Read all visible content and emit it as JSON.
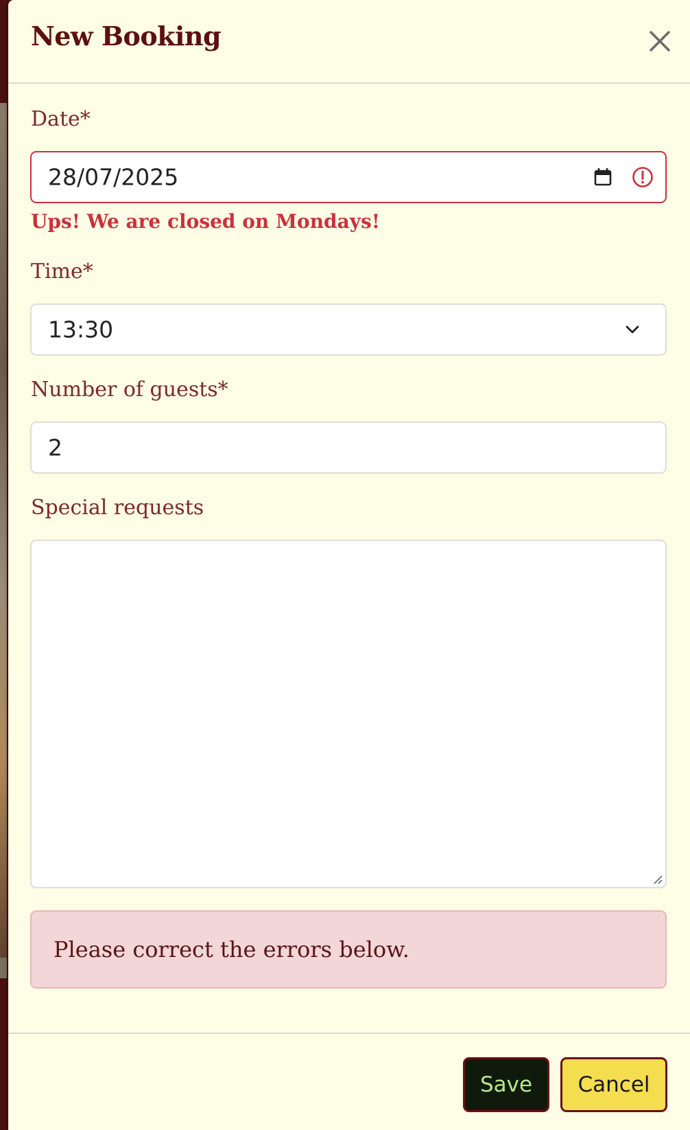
{
  "modal": {
    "title": "New Booking"
  },
  "form": {
    "date": {
      "label": "Date*",
      "value": "28/07/2025",
      "error": "Ups! We are closed on Mondays!"
    },
    "time": {
      "label": "Time*",
      "value": "13:30"
    },
    "guests": {
      "label": "Number of guests*",
      "value": "2"
    },
    "special_requests": {
      "label": "Special requests",
      "value": ""
    }
  },
  "alert": {
    "message": "Please correct the errors below."
  },
  "footer": {
    "save_label": "Save",
    "cancel_label": "Cancel"
  },
  "colors": {
    "modal_background": "#fefde5",
    "title": "#5c1010",
    "label": "#7a2a2a",
    "error": "#c8323d",
    "alert_background": "#f2d6d8",
    "save_background": "#101a0c",
    "save_text": "#b8e88a",
    "cancel_background": "#f5dd50",
    "button_border": "#6a1010"
  },
  "icons": {
    "close": "close-icon",
    "calendar": "calendar-icon",
    "error": "exclamation-circle-icon",
    "select": "chevron-down-icon",
    "resize": "resize-handle-icon"
  }
}
